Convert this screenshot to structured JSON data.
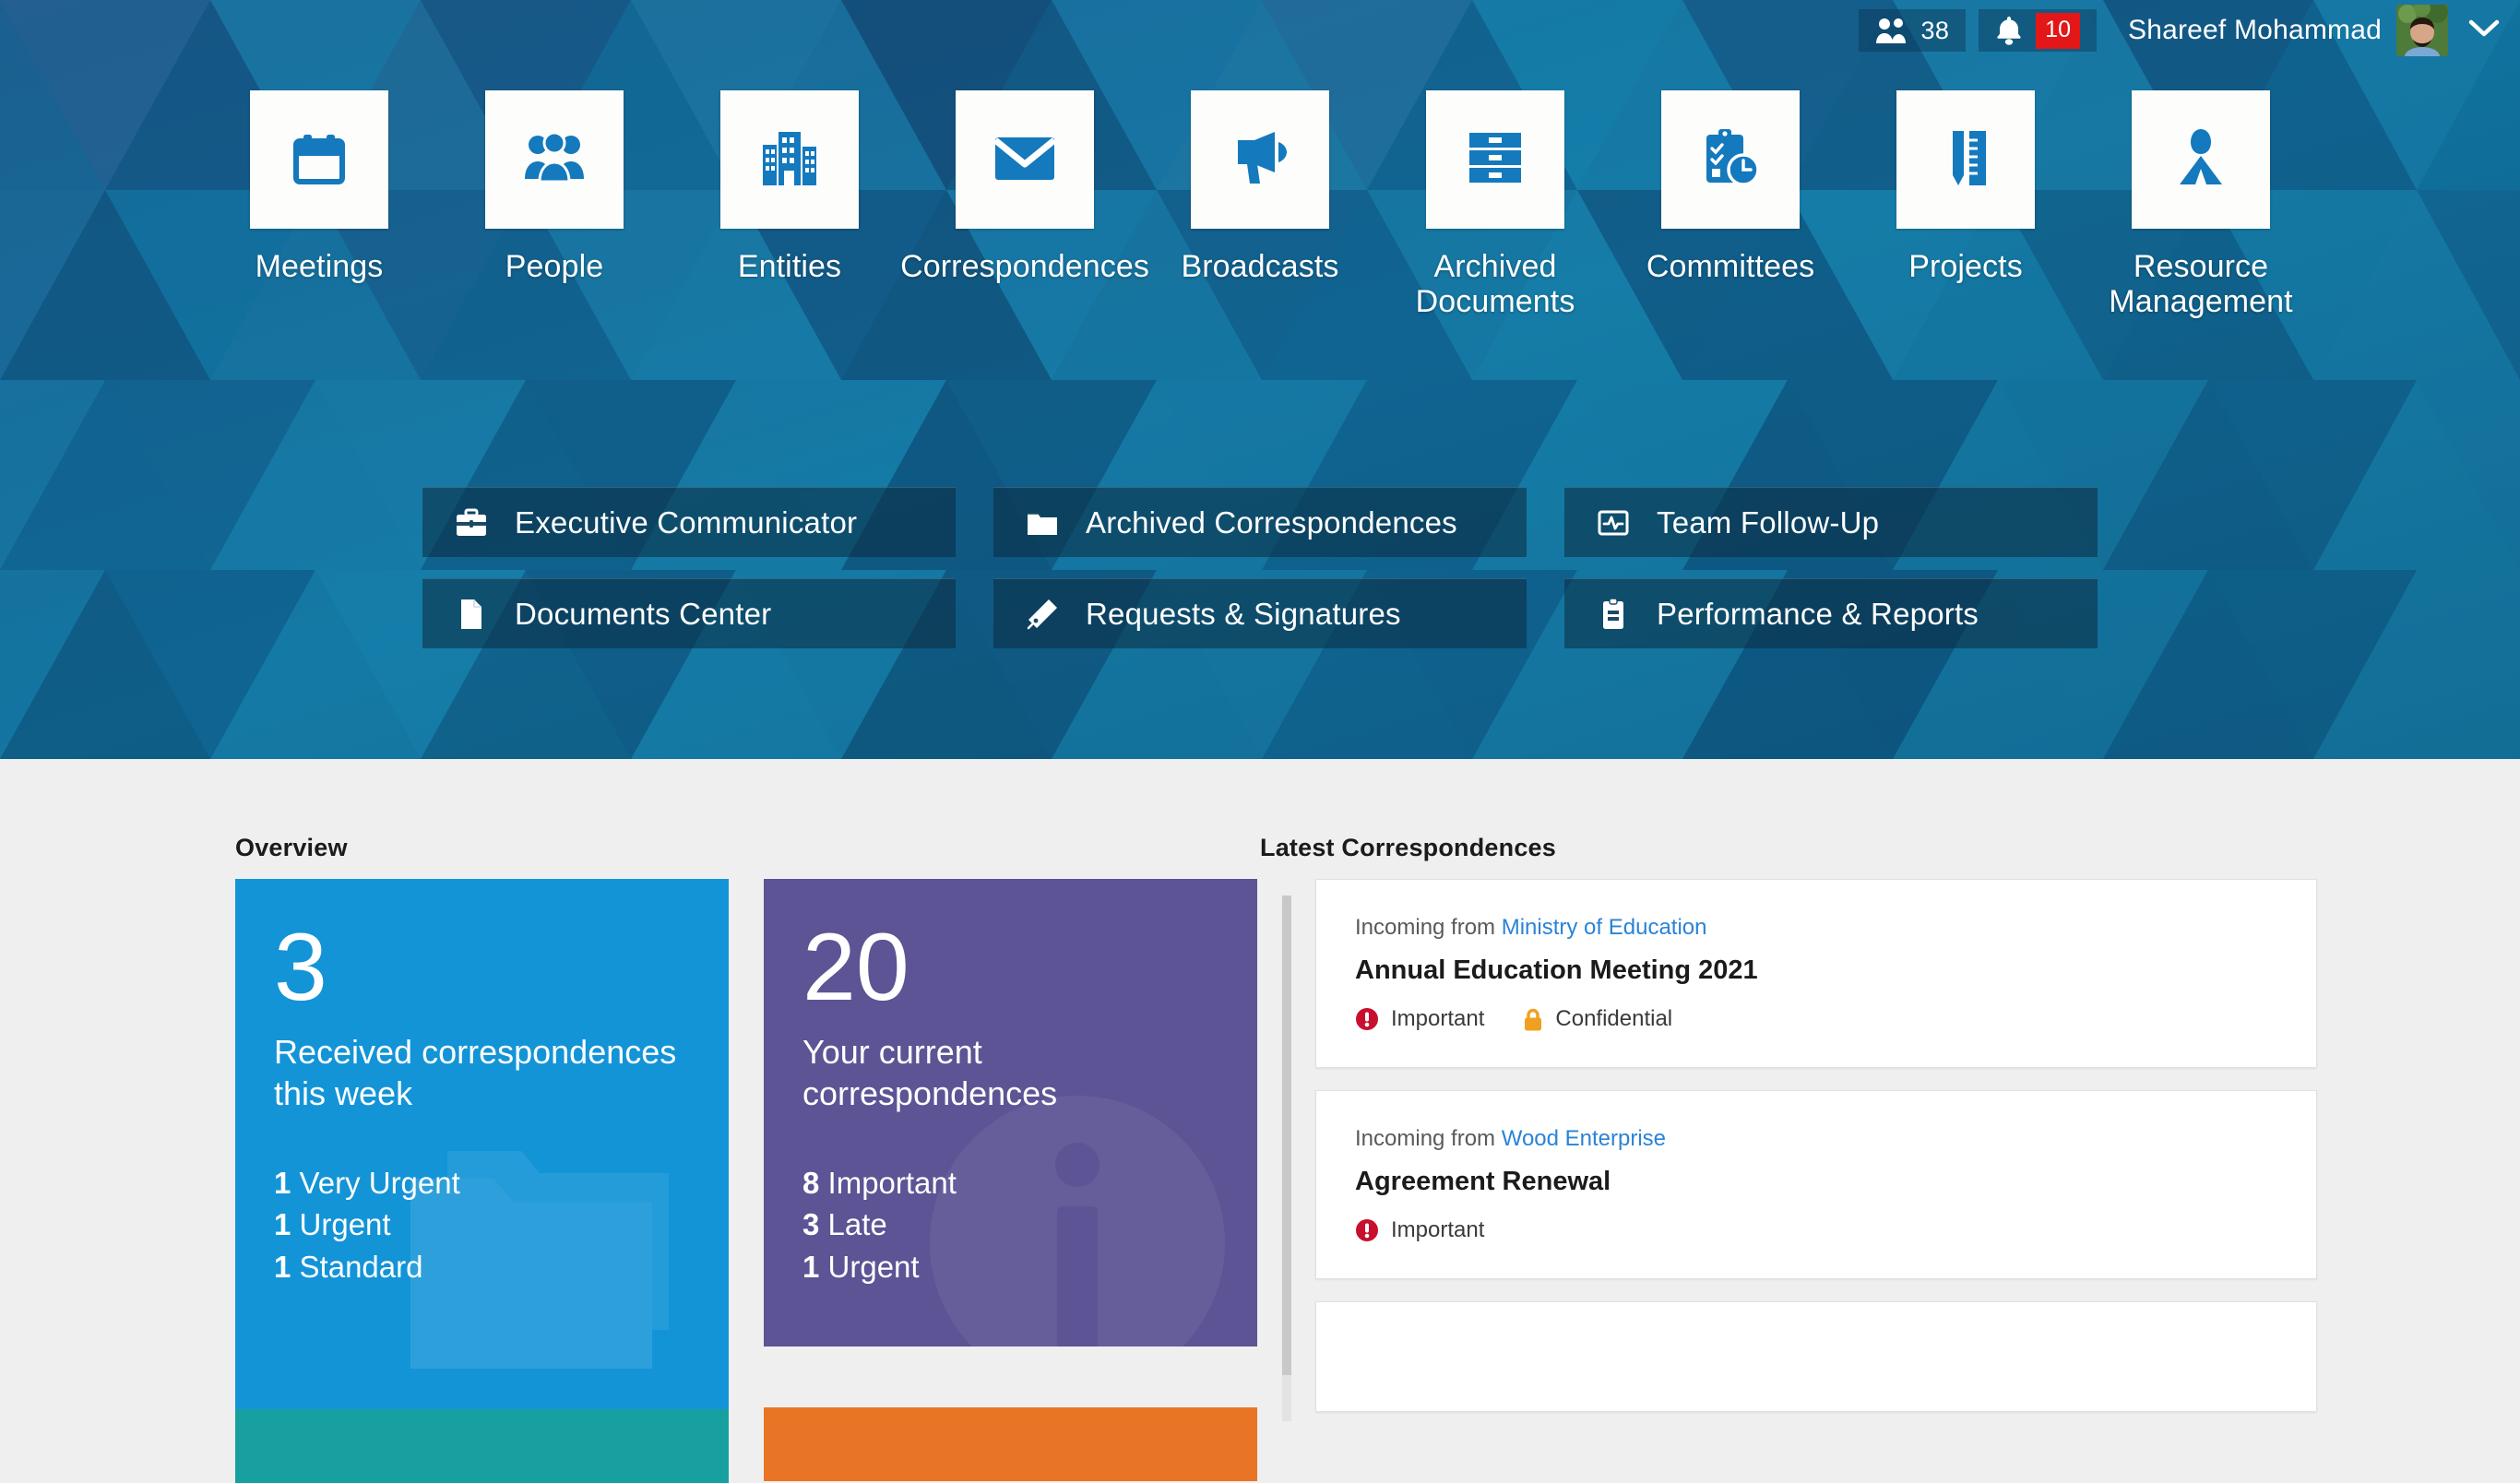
{
  "topbar": {
    "people_icon": "people-icon",
    "people_count": "38",
    "bell_icon": "bell-icon",
    "notification_count": "10",
    "username": "Shareef Mohammad",
    "avatar_icon": "user-avatar",
    "chevron_icon": "chevron-down-icon"
  },
  "tiles": [
    {
      "label": "Meetings",
      "icon": "calendar-icon"
    },
    {
      "label": "People",
      "icon": "people-group-icon"
    },
    {
      "label": "Entities",
      "icon": "buildings-icon"
    },
    {
      "label": "Correspondences",
      "icon": "envelope-icon"
    },
    {
      "label": "Broadcasts",
      "icon": "megaphone-icon"
    },
    {
      "label": "Archived\nDocuments",
      "icon": "file-cabinet-icon"
    },
    {
      "label": "Committees",
      "icon": "clipboard-clock-icon"
    },
    {
      "label": "Projects",
      "icon": "pencil-ruler-icon"
    },
    {
      "label": "Resource\nManagement",
      "icon": "person-resource-icon"
    }
  ],
  "actions": [
    {
      "label": "Executive Communicator",
      "icon": "briefcase-icon"
    },
    {
      "label": "Archived Correspondences",
      "icon": "folder-icon"
    },
    {
      "label": "Team Follow-Up",
      "icon": "pulse-monitor-icon"
    },
    {
      "label": "Documents Center",
      "icon": "document-icon"
    },
    {
      "label": "Requests & Signatures",
      "icon": "fountain-pen-icon"
    },
    {
      "label": "Performance & Reports",
      "icon": "clipboard-report-icon"
    }
  ],
  "overview": {
    "title": "Overview",
    "cards": [
      {
        "number": "3",
        "description": "Received correspondences this week",
        "color": "#1394d7",
        "watermark": "folders-icon",
        "stats": [
          {
            "count": "1",
            "label": "Very Urgent"
          },
          {
            "count": "1",
            "label": "Urgent"
          },
          {
            "count": "1",
            "label": "Standard"
          }
        ]
      },
      {
        "number": "20",
        "description": "Your current correspondences",
        "color": "#5c5494",
        "watermark": "info-icon",
        "stats": [
          {
            "count": "8",
            "label": "Important"
          },
          {
            "count": "3",
            "label": "Late"
          },
          {
            "count": "1",
            "label": "Urgent"
          }
        ]
      }
    ],
    "extra_cards": [
      {
        "color": "#18a0a0"
      },
      {
        "color": "#e87525"
      }
    ]
  },
  "latest": {
    "title": "Latest Correspondences",
    "items": [
      {
        "from_prefix": "Incoming from ",
        "org": "Ministry of Education",
        "subject": "Annual Education Meeting 2021",
        "tags": [
          {
            "label": "Important",
            "icon": "exclamation-circle-icon",
            "color": "#c8102e"
          },
          {
            "label": "Confidential",
            "icon": "lock-icon",
            "color": "#f0a020"
          }
        ]
      },
      {
        "from_prefix": "Incoming from ",
        "org": "Wood Enterprise",
        "subject": "Agreement Renewal",
        "tags": [
          {
            "label": "Important",
            "icon": "exclamation-circle-icon",
            "color": "#c8102e"
          }
        ]
      }
    ]
  },
  "colors": {
    "brand_blue": "#1479bd",
    "accent_cyan": "#1394d7",
    "purple": "#5c5494",
    "teal": "#18a0a0",
    "orange": "#e87525",
    "danger_red": "#e31717",
    "link_blue": "#2b83d6",
    "page_bg": "#efefef"
  }
}
